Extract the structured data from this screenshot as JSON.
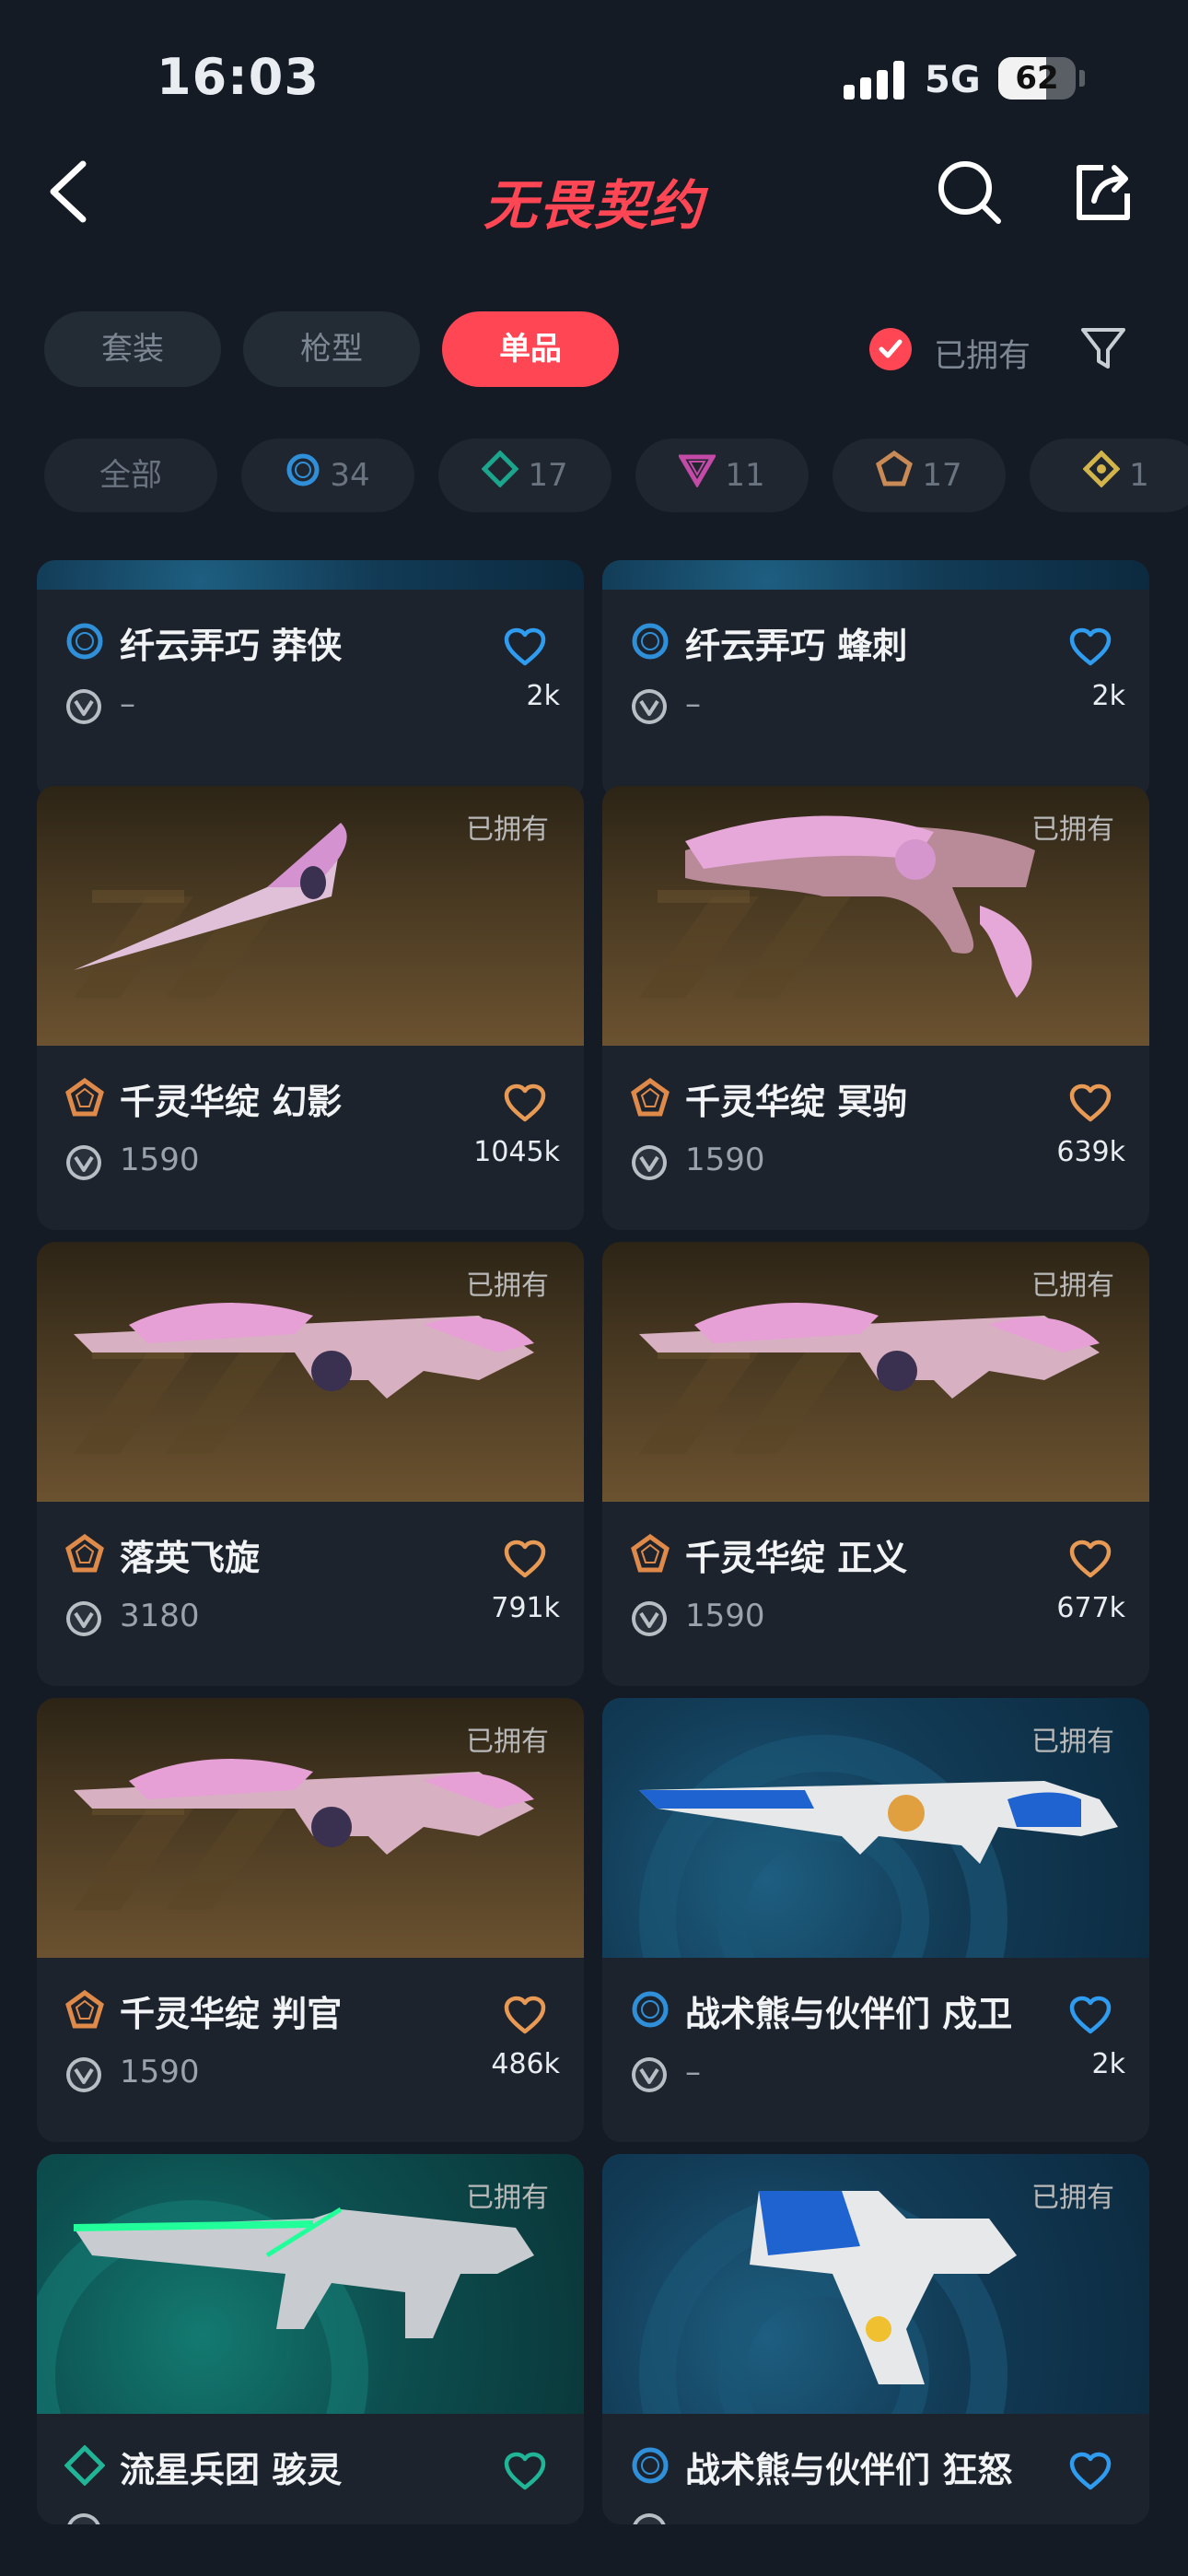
{
  "status": {
    "time": "16:03",
    "network": "5G",
    "battery": "62",
    "battery_level": 0.62
  },
  "header": {
    "title": "无畏契约"
  },
  "tabs": [
    {
      "label": "套装",
      "active": false
    },
    {
      "label": "枪型",
      "active": false
    },
    {
      "label": "单品",
      "active": true
    }
  ],
  "owned_filter": {
    "label": "已拥有",
    "checked": true
  },
  "tiers": [
    {
      "label": "全部",
      "icon": "all",
      "color": ""
    },
    {
      "label": "34",
      "icon": "select-tier-icon",
      "color": "#2f8fd8"
    },
    {
      "label": "17",
      "icon": "deluxe-tier-icon",
      "color": "#1aa58c"
    },
    {
      "label": "11",
      "icon": "premium-tier-icon",
      "color": "#c34aa6"
    },
    {
      "label": "17",
      "icon": "exclusive-tier-icon",
      "color": "#c98a55"
    },
    {
      "label": "1",
      "icon": "ultra-tier-icon",
      "color": "#d2b44a"
    }
  ],
  "cards": [
    {
      "name": "纤云弄巧 莽侠",
      "price": "–",
      "likes": "2k",
      "owned": "",
      "tier": "select",
      "heart_color": "#2f9cf0",
      "bg": "blue"
    },
    {
      "name": "纤云弄巧 蜂刺",
      "price": "–",
      "likes": "2k",
      "owned": "",
      "tier": "select",
      "heart_color": "#2f9cf0",
      "bg": "blue"
    },
    {
      "name": "千灵华绽 幻影",
      "price": "1590",
      "likes": "1045k",
      "owned": "已拥有",
      "tier": "exclusive",
      "heart_color": "#e89a55",
      "bg": "gold"
    },
    {
      "name": "千灵华绽 冥驹",
      "price": "1590",
      "likes": "639k",
      "owned": "已拥有",
      "tier": "exclusive",
      "heart_color": "#e89a55",
      "bg": "gold"
    },
    {
      "name": "落英飞旋",
      "price": "3180",
      "likes": "791k",
      "owned": "已拥有",
      "tier": "exclusive",
      "heart_color": "#e89a55",
      "bg": "gold"
    },
    {
      "name": "千灵华绽 正义",
      "price": "1590",
      "likes": "677k",
      "owned": "已拥有",
      "tier": "exclusive",
      "heart_color": "#e89a55",
      "bg": "gold"
    },
    {
      "name": "千灵华绽 判官",
      "price": "1590",
      "likes": "486k",
      "owned": "已拥有",
      "tier": "exclusive",
      "heart_color": "#e89a55",
      "bg": "gold"
    },
    {
      "name": "战术熊与伙伴们 戍卫",
      "price": "–",
      "likes": "2k",
      "owned": "已拥有",
      "tier": "select",
      "heart_color": "#2f9cf0",
      "bg": "blue"
    },
    {
      "name": "流星兵团 骇灵",
      "price": "",
      "likes": "",
      "owned": "已拥有",
      "tier": "deluxe",
      "heart_color": "#1fb596",
      "bg": "teal"
    },
    {
      "name": "战术熊与伙伴们 狂怒",
      "price": "",
      "likes": "",
      "owned": "已拥有",
      "tier": "select",
      "heart_color": "#2f9cf0",
      "bg": "blue"
    }
  ]
}
